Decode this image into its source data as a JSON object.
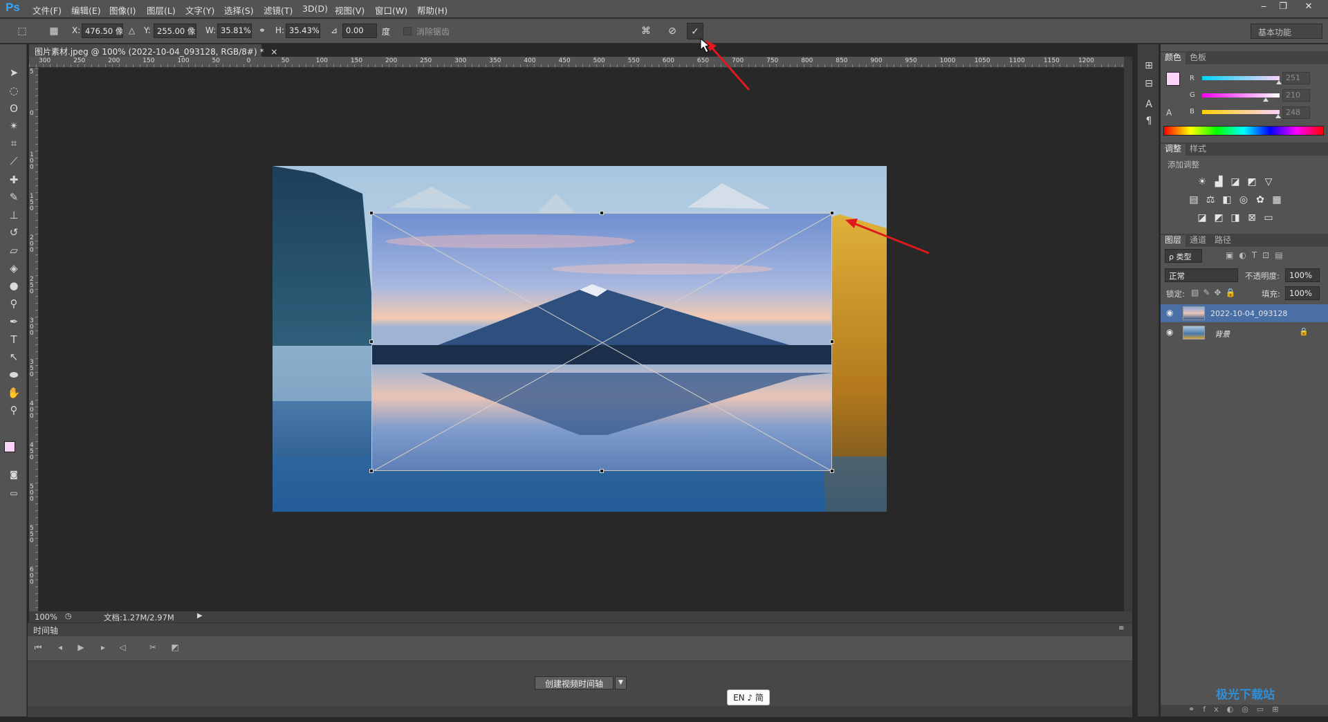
{
  "app": {
    "logo": "Ps"
  },
  "menu": [
    "文件(F)",
    "编辑(E)",
    "图像(I)",
    "图层(L)",
    "文字(Y)",
    "选择(S)",
    "滤镜(T)",
    "3D(D)",
    "视图(V)",
    "窗口(W)",
    "帮助(H)"
  ],
  "window_controls": {
    "minimize": "‒",
    "restore": "❐",
    "close": "✕"
  },
  "options": {
    "x_label": "X:",
    "x_value": "476.50 像素",
    "y_label": "Y:",
    "y_value": "255.00 像素",
    "w_label": "W:",
    "w_value": "35.81%",
    "h_label": "H:",
    "h_value": "35.43%",
    "angle_value": "0.00",
    "angle_unit": "度",
    "smooth_label": "消除锯齿",
    "workspace": "基本功能"
  },
  "document": {
    "tab_title": "图片素材.jpeg @ 100% (2022-10-04_093128, RGB/8#) *",
    "tab_close": "×",
    "ruler_top_labels": [
      "300",
      "250",
      "200",
      "150",
      "100",
      "50",
      "0",
      "50",
      "100",
      "150",
      "200",
      "250",
      "300",
      "350",
      "400",
      "450",
      "500",
      "550",
      "600",
      "650",
      "700",
      "750",
      "800",
      "850",
      "900",
      "950",
      "1000",
      "1050",
      "1100",
      "1150",
      "1200"
    ],
    "ruler_left_labels": [
      "5",
      "0",
      "1 0 0",
      "1 5 0",
      "2 0 0",
      "2 5 0",
      "3 0 0",
      "3 5 0",
      "4 0 0",
      "4 5 0",
      "5 0 0",
      "5 5 0",
      "6 0 0"
    ]
  },
  "status": {
    "zoom": "100%",
    "doc_info": "文档:1.27M/2.97M"
  },
  "timeline": {
    "title": "时间轴",
    "create_button": "创建视频时间轴",
    "dropdown": "▼"
  },
  "ime": {
    "text": "EN ♪ 简"
  },
  "color_panel": {
    "tabs": [
      "颜色",
      "色板"
    ],
    "r_label": "R",
    "r_value": "251",
    "r_level": 0.98,
    "g_label": "G",
    "g_value": "210",
    "g_level": 0.82,
    "b_label": "B",
    "b_value": "248",
    "b_level": 0.97,
    "foreground": "#fbd2f8"
  },
  "adjust_panel": {
    "tabs": [
      "调整",
      "样式"
    ],
    "add_label": "添加调整"
  },
  "layers_panel": {
    "tabs": [
      "图层",
      "通道",
      "路径"
    ],
    "kind_filter": "ρ 类型",
    "blend_mode": "正常",
    "opacity_label": "不透明度:",
    "opacity_value": "100%",
    "lock_label": "锁定:",
    "fill_label": "填充:",
    "fill_value": "100%",
    "layers": [
      {
        "name": "2022-10-04_093128",
        "selected": true,
        "locked": false
      },
      {
        "name": "背景",
        "selected": false,
        "locked": true
      }
    ]
  },
  "watermark": "极光下载站",
  "colors": {
    "accent_arrow": "#e0191d",
    "selection_blue": "#4a6fa5"
  }
}
